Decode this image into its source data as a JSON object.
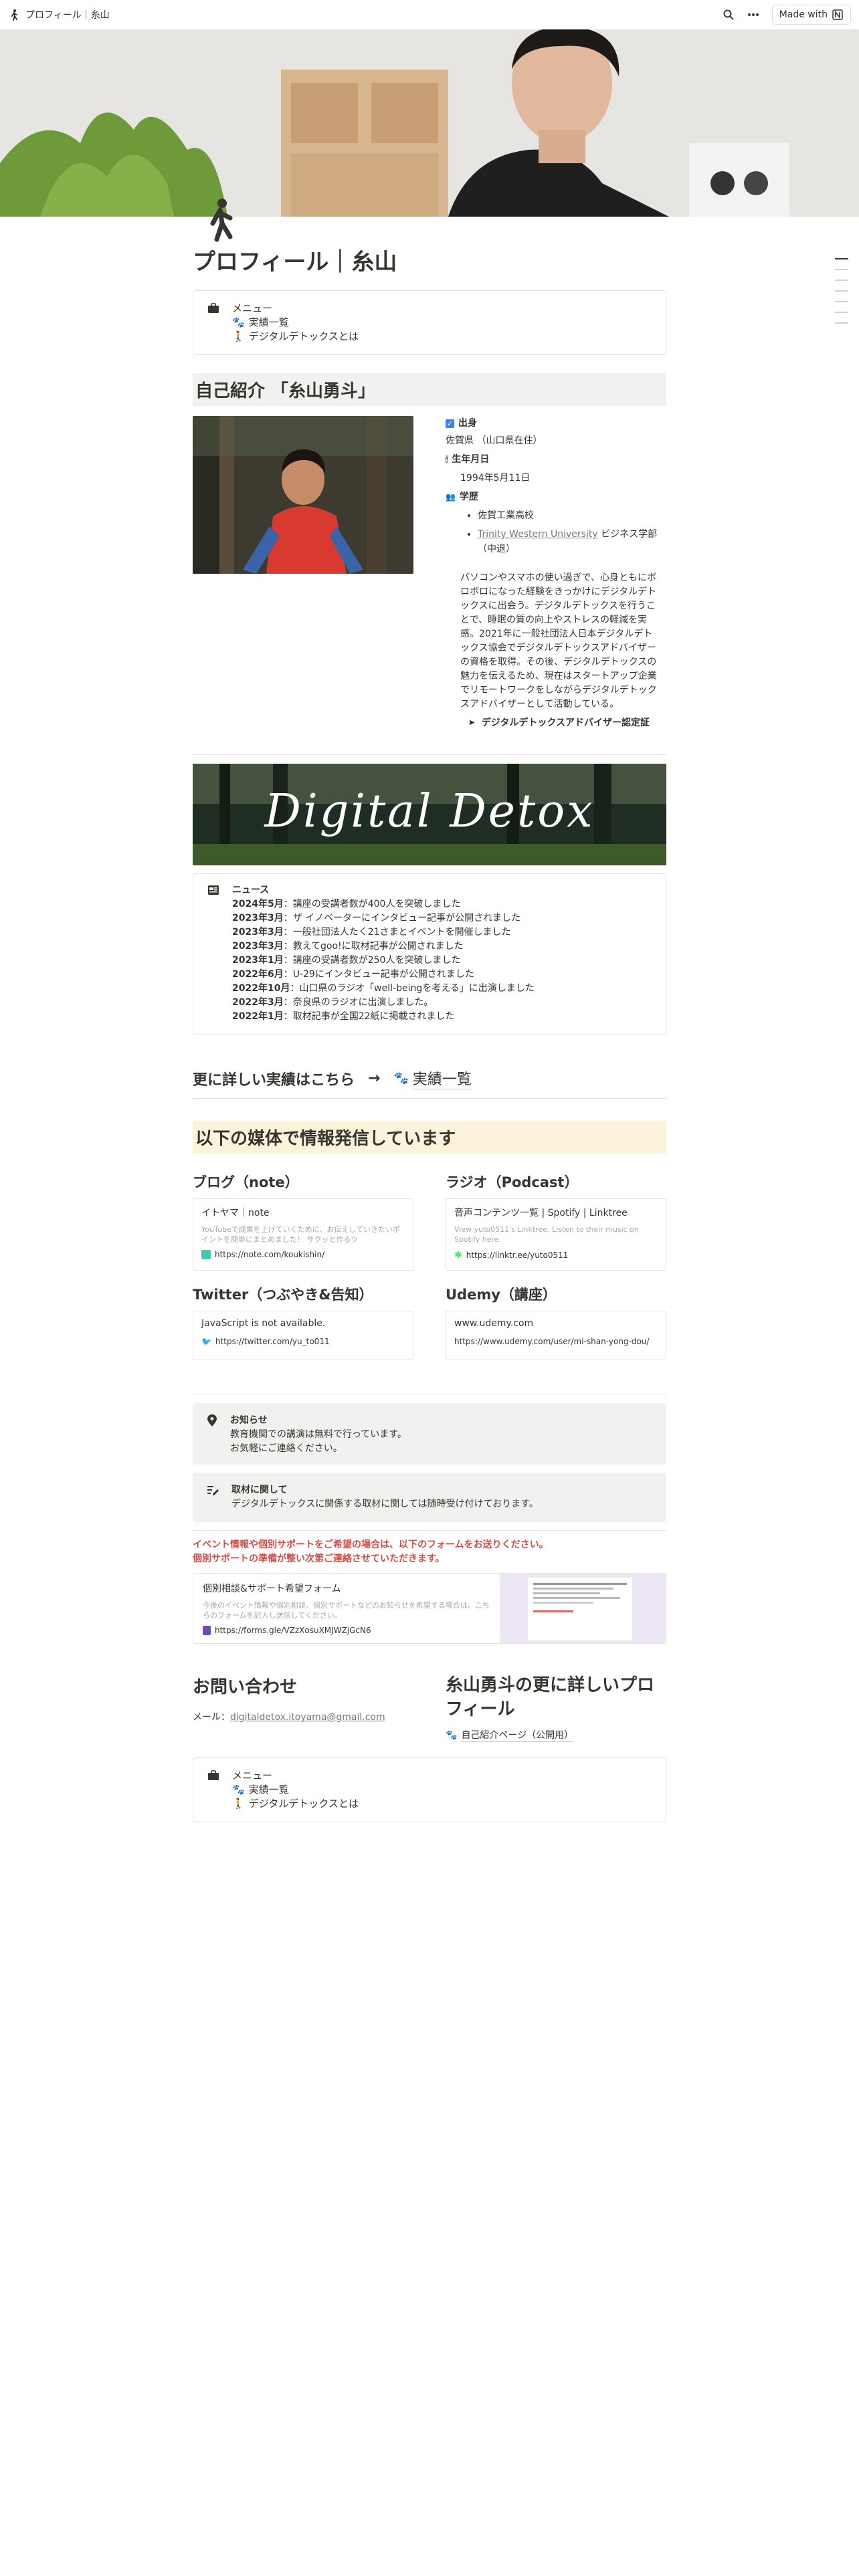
{
  "topbar": {
    "breadcrumb": "プロフィール｜糸山",
    "made_with": "Made with"
  },
  "page": {
    "title": "プロフィール｜糸山"
  },
  "menu": {
    "heading": "メニュー",
    "items": [
      "実績一覧",
      "デジタルデトックスとは"
    ]
  },
  "intro": {
    "heading": "自己紹介 「糸山勇斗」",
    "birthplace_label": "出身",
    "birthplace_value": "佐賀県 （山口県在住）",
    "birthday_label": "生年月日",
    "birthday_value": "1994年5月11日",
    "education_label": "学歴",
    "education": [
      "佐賀工業高校",
      "Trinity Western University",
      "ビジネス学部（中退）"
    ],
    "bio": "パソコンやスマホの使い過ぎで、心身ともにボロボロになった経験をきっかけにデジタルデトックスに出会う。デジタルデトックスを行うことで、睡眠の質の向上やストレスの軽減を実感。2021年に一般社団法人日本デジタルデトックス協会でデジタルデトックスアドバイザーの資格を取得。その後、デジタルデトックスの魅力を伝えるため、現在はスタートアップ企業でリモートワークをしながらデジタルデトックスアドバイザーとして活動している。",
    "toggle": "デジタルデトックスアドバイザー認定証"
  },
  "banner": {
    "text": "Digital Detox"
  },
  "news": {
    "heading": "ニュース",
    "items": [
      {
        "date": "2024年5月",
        "text": "：講座の受講者数が400人を突破しました"
      },
      {
        "date": "2023年3月",
        "text": "：ザ イノベーターにインタビュー記事が公開されました"
      },
      {
        "date": "2023年3月",
        "text": "：一般社団法人たく21さまとイベントを開催しました"
      },
      {
        "date": "2023年3月",
        "text": "：教えてgoo!に取材記事が公開されました"
      },
      {
        "date": "2023年1月",
        "text": "：講座の受講者数が250人を突破しました"
      },
      {
        "date": "2022年6月",
        "text": "：U-29にインタビュー記事が公開されました"
      },
      {
        "date": "2022年10月",
        "text": "：山口県のラジオ「well-beingを考える」に出演しました"
      },
      {
        "date": "2022年3月",
        "text": "：奈良県のラジオに出演しました。"
      },
      {
        "date": "2022年1月",
        "text": "：取材記事が全国22紙に掲載されました"
      }
    ]
  },
  "achievements": {
    "lead": "更に詳しい実績はこちら",
    "arrow": "→",
    "link": "実績一覧"
  },
  "media": {
    "heading": "以下の媒体で情報発信しています",
    "blog": {
      "heading": "ブログ（note）",
      "title": "イトヤマ｜note",
      "desc": "YouTubeで成果を上げていくために、お伝えしていきたいポイントを簡単にまとめました！ サクッと作るツ",
      "url": "https://note.com/koukishin/"
    },
    "radio": {
      "heading": "ラジオ（Podcast）",
      "title": "音声コンテンツ一覧 | Spotify | Linktree",
      "desc": "View yuto0511's Linktree. Listen to their music on Spotify here.",
      "url": "https://linktr.ee/yuto0511"
    },
    "twitter": {
      "heading": "Twitter（つぶやき&告知）",
      "title": "JavaScript is not available.",
      "url": "https://twitter.com/yu_to011"
    },
    "udemy": {
      "heading": "Udemy（講座）",
      "title": "www.udemy.com",
      "url": "https://www.udemy.com/user/mi-shan-yong-dou/"
    }
  },
  "notices": {
    "notice_title": "お知らせ",
    "notice_lines": [
      "教育機関での講演は無料で行っています。",
      "お気軽にご連絡ください。"
    ],
    "coverage_title": "取材に関して",
    "coverage_line": "デジタルデトックスに関係する取材に関しては随時受け付けております。",
    "alert_lines": [
      "イベント情報や個別サポートをご希望の場合は、以下のフォームをお送りください。",
      "個別サポートの準備が整い次第ご連絡させていただきます。"
    ],
    "form_title": "個別相談&サポート希望フォーム",
    "form_desc": "今後のイベント情報や個別相談、個別サポートなどのお知らせを希望する場合は、こちらのフォームを記入し送信してください。",
    "form_url": "https://forms.gle/VZzXosuXMJWZjGcN6"
  },
  "contact": {
    "heading": "お問い合わせ",
    "email_label": "メール：",
    "email": "digitaldetox.itoyama@gmail.com",
    "more_heading": "糸山勇斗の更に詳しいプロフィール",
    "more_link": "自己紹介ページ（公開用）"
  },
  "colors": {
    "text": "#37352f",
    "muted": "#787774",
    "gray_bg": "#f1f1ef",
    "yellow_bg": "#fbf3db",
    "alert_red": "#d44c47"
  }
}
